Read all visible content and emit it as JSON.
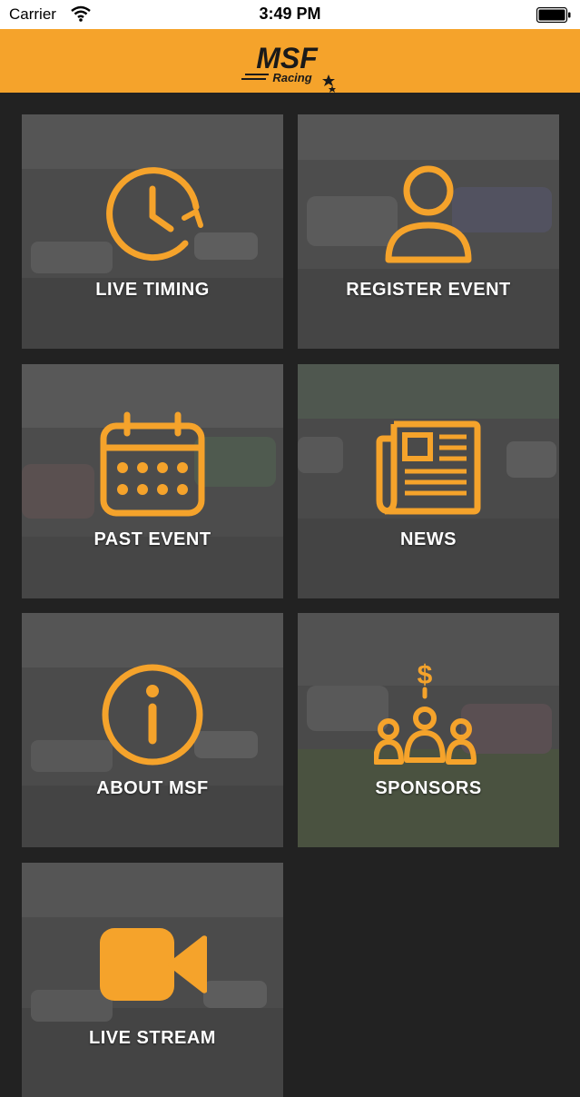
{
  "status_bar": {
    "carrier": "Carrier",
    "time": "3:49 PM"
  },
  "header": {
    "logo_text": "MSF",
    "logo_subtext": "Racing"
  },
  "colors": {
    "accent": "#f5a32b",
    "background": "#222222",
    "tile_overlay": "#4a4a4a"
  },
  "tiles": [
    {
      "label": "LIVE TIMING",
      "icon": "clock-refresh-icon"
    },
    {
      "label": "REGISTER EVENT",
      "icon": "user-icon"
    },
    {
      "label": "PAST EVENT",
      "icon": "calendar-icon"
    },
    {
      "label": "NEWS",
      "icon": "newspaper-icon"
    },
    {
      "label": "ABOUT MSF",
      "icon": "info-icon"
    },
    {
      "label": "SPONSORS",
      "icon": "sponsors-icon"
    },
    {
      "label": "LIVE STREAM",
      "icon": "video-camera-icon"
    }
  ]
}
